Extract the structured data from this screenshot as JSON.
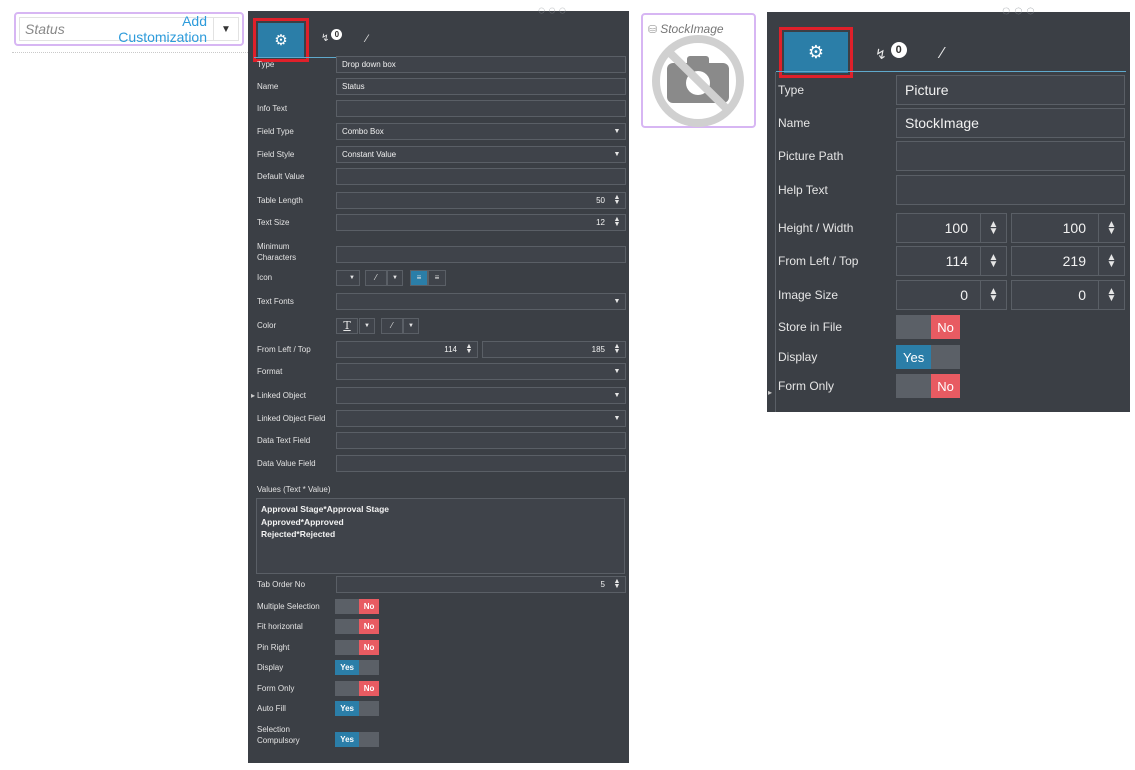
{
  "status_widget": {
    "label": "Status",
    "value": "Add Customization"
  },
  "panel1": {
    "badge": "0",
    "type": {
      "label": "Type",
      "value": "Drop down box"
    },
    "name": {
      "label": "Name",
      "value": "Status"
    },
    "info_text": {
      "label": "Info Text",
      "value": ""
    },
    "field_type": {
      "label": "Field Type",
      "value": "Combo Box"
    },
    "field_style": {
      "label": "Field Style",
      "value": "Constant Value"
    },
    "default_value": {
      "label": "Default Value",
      "value": ""
    },
    "table_length": {
      "label": "Table Length",
      "value": "50"
    },
    "text_size": {
      "label": "Text Size",
      "value": "12"
    },
    "minimum_characters": {
      "label": "Minimum Characters",
      "value": ""
    },
    "icon": {
      "label": "Icon"
    },
    "text_fonts": {
      "label": "Text Fonts",
      "value": ""
    },
    "color": {
      "label": "Color",
      "text_glyph": "T"
    },
    "from_left_top": {
      "label": "From Left / Top",
      "left": "114",
      "top": "185"
    },
    "format": {
      "label": "Format",
      "value": ""
    },
    "linked_object": {
      "label": "Linked Object",
      "value": ""
    },
    "linked_object_field": {
      "label": "Linked Object Field",
      "value": ""
    },
    "data_text_field": {
      "label": "Data Text Field",
      "value": ""
    },
    "data_value_field": {
      "label": "Data Value Field",
      "value": ""
    },
    "values": {
      "label": "Values (Text * Value)",
      "lines": [
        "Approval Stage*Approval Stage",
        "Approved*Approved",
        "Rejected*Rejected"
      ]
    },
    "tab_order_no": {
      "label": "Tab Order No",
      "value": "5"
    },
    "multiple_selection": {
      "label": "Multiple Selection",
      "state": "No"
    },
    "fit_horizontal": {
      "label": "Fit horizontal",
      "state": "No"
    },
    "pin_right": {
      "label": "Pin Right",
      "state": "No"
    },
    "display": {
      "label": "Display",
      "state": "Yes"
    },
    "form_only": {
      "label": "Form Only",
      "state": "No"
    },
    "auto_fill": {
      "label": "Auto Fill",
      "state": "Yes"
    },
    "selection_compulsory": {
      "label": "Selection Compulsory",
      "state": "Yes"
    }
  },
  "stock_widget": {
    "title": "StockImage"
  },
  "panel2": {
    "badge": "0",
    "type": {
      "label": "Type",
      "value": "Picture"
    },
    "name": {
      "label": "Name",
      "value": "StockImage"
    },
    "picture_path": {
      "label": "Picture Path",
      "value": ""
    },
    "help_text": {
      "label": "Help Text",
      "value": ""
    },
    "height_width": {
      "label": "Height / Width",
      "height": "100",
      "width": "100"
    },
    "from_left_top": {
      "label": "From Left / Top",
      "left": "114",
      "top": "219"
    },
    "image_size": {
      "label": "Image Size",
      "a": "0",
      "b": "0"
    },
    "store_in_file": {
      "label": "Store in File",
      "state": "No"
    },
    "display": {
      "label": "Display",
      "state": "Yes"
    },
    "form_only": {
      "label": "Form Only",
      "state": "No"
    }
  },
  "colors": {
    "panel_bg": "#3b3f45",
    "accent": "#2b7ea8",
    "no_red": "#e85b62",
    "highlight": "#e0202a",
    "selection": "#d7b6f3"
  }
}
